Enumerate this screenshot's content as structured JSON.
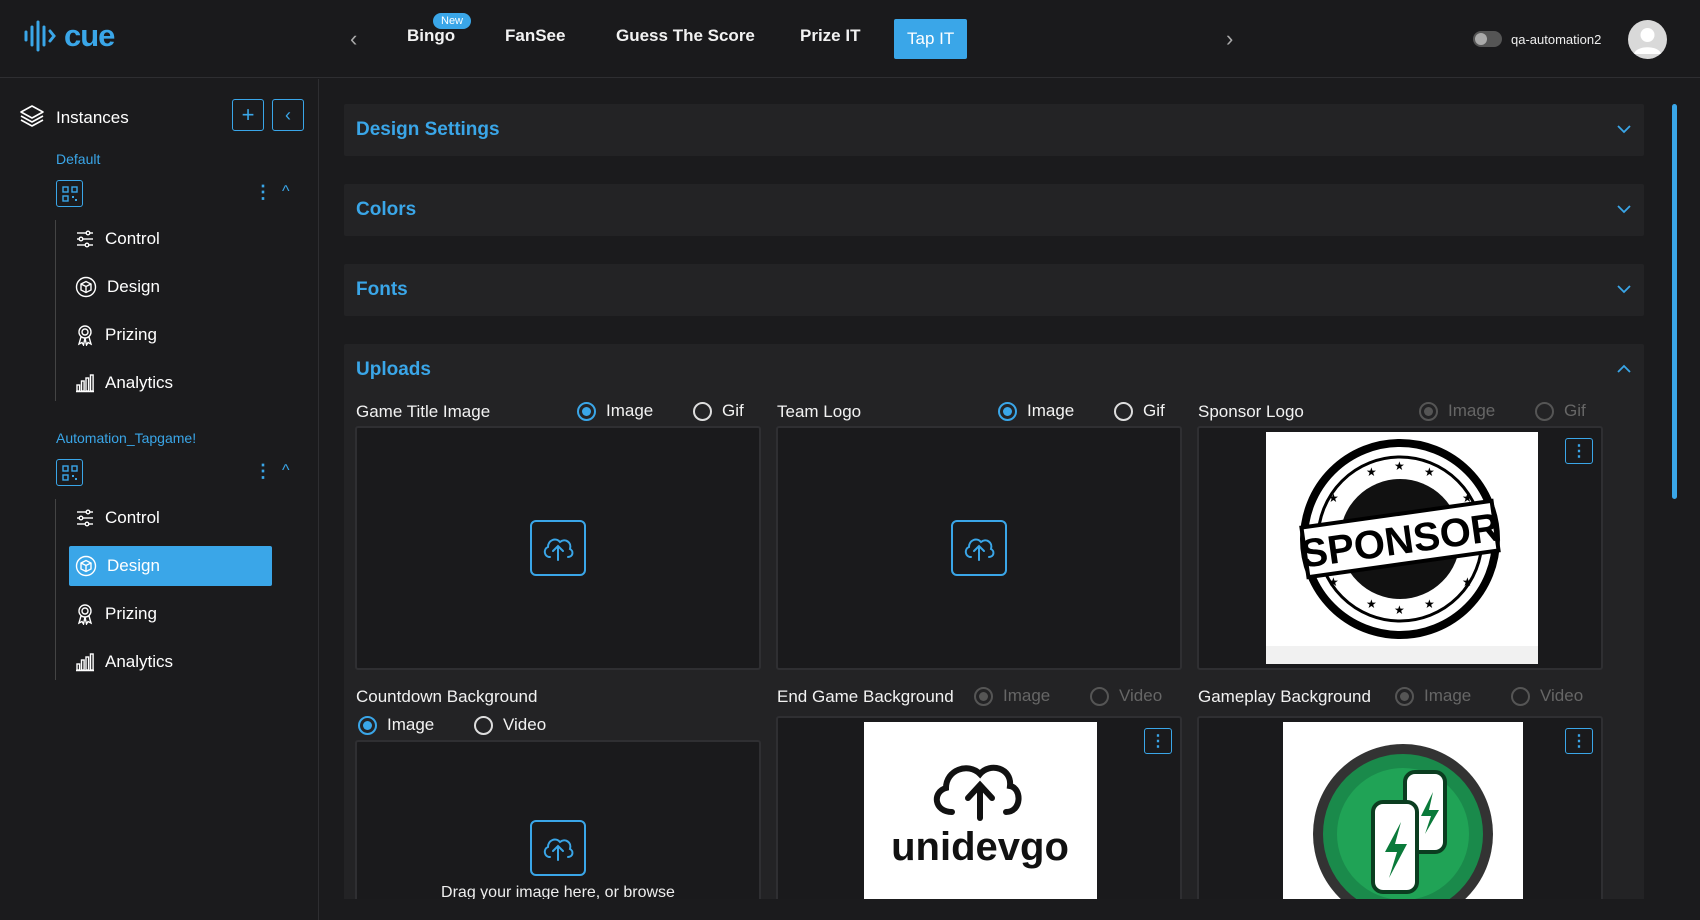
{
  "app": {
    "logo_text": "cue",
    "accent": "#3aa6e8"
  },
  "topnav": {
    "tabs": [
      {
        "label": "Bingo",
        "badge": "New"
      },
      {
        "label": "FanSee"
      },
      {
        "label": "Guess The Score"
      },
      {
        "label": "Prize IT"
      },
      {
        "label": "Tap IT",
        "active": true
      }
    ],
    "username": "qa-automation2"
  },
  "sidebar": {
    "title": "Instances",
    "instances": [
      {
        "name": "Default",
        "items": [
          "Control",
          "Design",
          "Prizing",
          "Analytics"
        ]
      },
      {
        "name": "Automation_Tapgame!",
        "items": [
          "Control",
          "Design",
          "Prizing",
          "Analytics"
        ],
        "active_item": "Design"
      }
    ]
  },
  "sections": {
    "design_settings": "Design Settings",
    "colors": "Colors",
    "fonts": "Fonts",
    "uploads": "Uploads"
  },
  "uploads": {
    "game_title": {
      "label": "Game Title Image",
      "opt1": "Image",
      "opt2": "Gif",
      "selected": "Image"
    },
    "team_logo": {
      "label": "Team Logo",
      "opt1": "Image",
      "opt2": "Gif",
      "selected": "Image"
    },
    "sponsor_logo": {
      "label": "Sponsor Logo",
      "opt1": "Image",
      "opt2": "Gif",
      "selected": "Image",
      "image_text": "SPONSOR"
    },
    "countdown_bg": {
      "label": "Countdown Background",
      "opt1": "Image",
      "opt2": "Video",
      "selected": "Image",
      "drop_text": "Drag your image here, or browse"
    },
    "end_game_bg": {
      "label": "End Game Background",
      "opt1": "Image",
      "opt2": "Video",
      "selected": "Image",
      "image_text": "unidevgo"
    },
    "gameplay_bg": {
      "label": "Gameplay Background",
      "opt1": "Image",
      "opt2": "Video",
      "selected": "Image"
    }
  }
}
